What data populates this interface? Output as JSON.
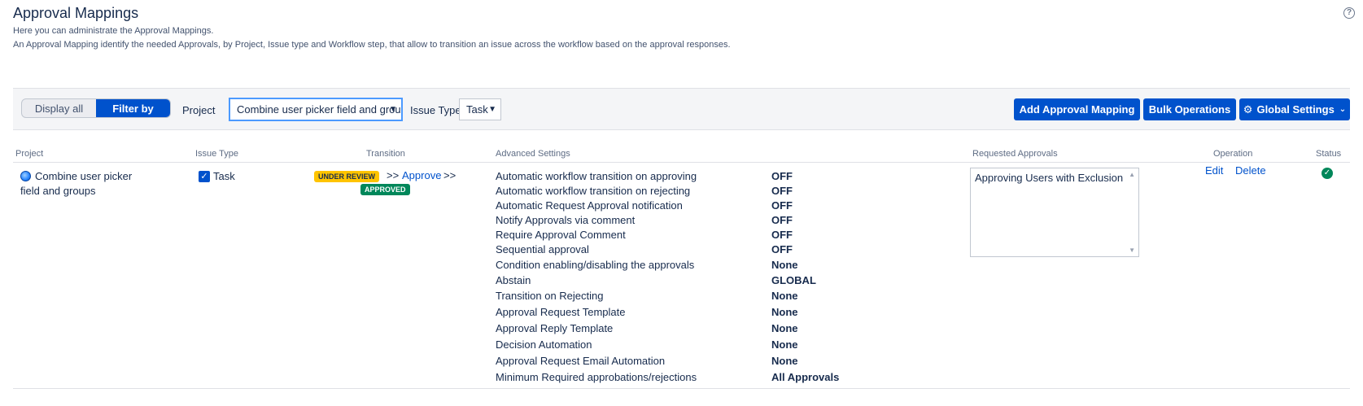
{
  "page": {
    "title": "Approval Mappings",
    "help_icon": "help-icon",
    "description_1": "Here you can administrate the Approval Mappings.",
    "description_2": "An Approval Mapping identify the needed Approvals, by Project, Issue type and Workflow step, that allow to transition an issue across the workflow based on the approval responses."
  },
  "toolbar": {
    "toggle": {
      "display_all": "Display all",
      "filter_by": "Filter by",
      "selected": "Filter by"
    },
    "project_label": "Project",
    "project_value": "Combine user picker field and groups",
    "issue_type_label": "Issue Type",
    "issue_type_value": "Task",
    "add_mapping_label": "Add Approval Mapping",
    "bulk_operations_label": "Bulk Operations",
    "global_settings_label": "Global Settings",
    "accent_color": "#0052cc"
  },
  "table": {
    "headers": {
      "project": "Project",
      "issue_type": "Issue Type",
      "transition": "Transition",
      "advanced_settings": "Advanced Settings",
      "requested_approvals": "Requested Approvals",
      "operation": "Operation",
      "status": "Status"
    },
    "rows": [
      {
        "project": "Combine user picker field and groups",
        "issue_type": "Task",
        "issue_type_checked": true,
        "transition": {
          "from_status": "UNDER REVIEW",
          "arrow_left": ">>",
          "action": "Approve",
          "arrow_right": ">>",
          "to_status": "APPROVED"
        },
        "settings": [
          {
            "name": "Automatic workflow transition on approving",
            "value": "OFF"
          },
          {
            "name": "Automatic workflow transition on rejecting",
            "value": "OFF"
          },
          {
            "name": "Automatic Request Approval notification",
            "value": "OFF"
          },
          {
            "name": "Notify Approvals via comment",
            "value": "OFF"
          },
          {
            "name": "Require Approval Comment",
            "value": "OFF"
          },
          {
            "name": "Sequential approval",
            "value": "OFF"
          },
          {
            "name": "Condition enabling/disabling the approvals",
            "value": "None"
          },
          {
            "name": "Abstain",
            "value": "GLOBAL"
          },
          {
            "name": "Transition on Rejecting",
            "value": "None"
          },
          {
            "name": "Approval Request Template",
            "value": "None"
          },
          {
            "name": "Approval Reply Template",
            "value": "None"
          },
          {
            "name": "Decision Automation",
            "value": "None"
          },
          {
            "name": "Approval Request Email Automation",
            "value": "None"
          },
          {
            "name": "Minimum Required approbations/rejections",
            "value": "All Approvals"
          }
        ],
        "requested_approvals": "Approving Users with Exclusion",
        "operations": {
          "edit": "Edit",
          "delete": "Delete"
        },
        "status_icon": "check-circle-icon",
        "status_color": "#00875a"
      }
    ]
  }
}
